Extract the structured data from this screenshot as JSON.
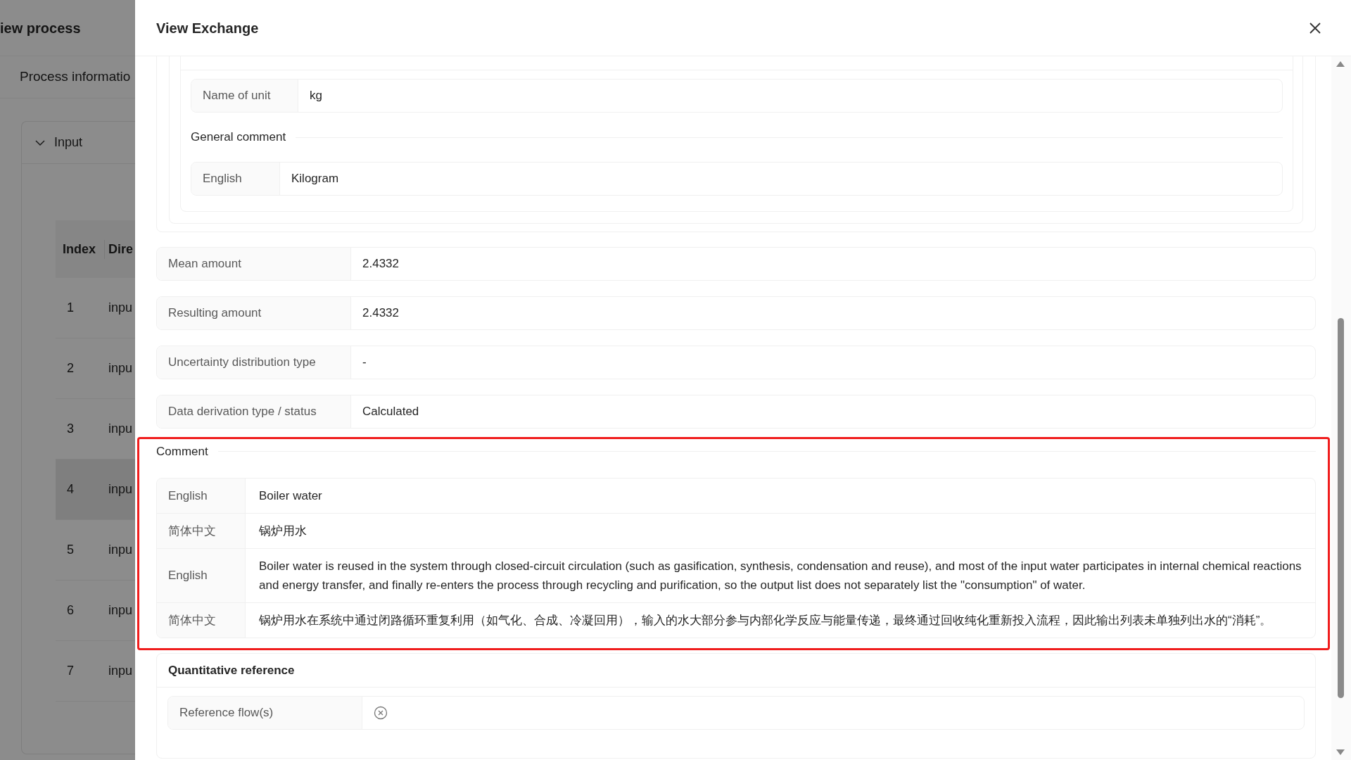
{
  "background": {
    "title": "iew process",
    "tab": "Process informatio",
    "section": {
      "label": "Input",
      "expanded": true
    },
    "table": {
      "columns": [
        "Index",
        "Dire"
      ],
      "rows": [
        {
          "index": "1",
          "direction": "inpu",
          "selected": false
        },
        {
          "index": "2",
          "direction": "inpu",
          "selected": false
        },
        {
          "index": "3",
          "direction": "inpu",
          "selected": false
        },
        {
          "index": "4",
          "direction": "inpu",
          "selected": true
        },
        {
          "index": "5",
          "direction": "inpu",
          "selected": false
        },
        {
          "index": "6",
          "direction": "inpu",
          "selected": false
        },
        {
          "index": "7",
          "direction": "inpu",
          "selected": false
        }
      ]
    }
  },
  "drawer": {
    "title": "View Exchange",
    "unit": {
      "label": "Name of unit",
      "value": "kg"
    },
    "general_comment": {
      "title": "General comment",
      "entries": [
        {
          "language": "English",
          "text": "Kilogram"
        }
      ]
    },
    "fields": [
      {
        "label": "Mean amount",
        "value": "2.4332"
      },
      {
        "label": "Resulting amount",
        "value": "2.4332"
      },
      {
        "label": "Uncertainty distribution type",
        "value": "-"
      },
      {
        "label": "Data derivation type / status",
        "value": "Calculated"
      }
    ],
    "comment": {
      "title": "Comment",
      "highlighted": true,
      "entries": [
        {
          "language": "English",
          "text": "Boiler water"
        },
        {
          "language": "简体中文",
          "text": "锅炉用水"
        },
        {
          "language": "English",
          "text": "Boiler water is reused in the system through closed-circuit circulation (such as gasification, synthesis, condensation and reuse), and most of the input water participates in internal chemical reactions and energy transfer, and finally re-enters the process through recycling and purification, so the output list does not separately list the \"consumption\" of water."
        },
        {
          "language": "简体中文",
          "text": "锅炉用水在系统中通过闭路循环重复利用（如气化、合成、冷凝回用），输入的水大部分参与内部化学反应与能量传递，最终通过回收纯化重新投入流程，因此输出列表未单独列出水的“消耗”。"
        }
      ]
    },
    "quantitative_reference": {
      "title": "Quantitative reference",
      "fields": [
        {
          "label": "Reference flow(s)"
        }
      ]
    }
  }
}
